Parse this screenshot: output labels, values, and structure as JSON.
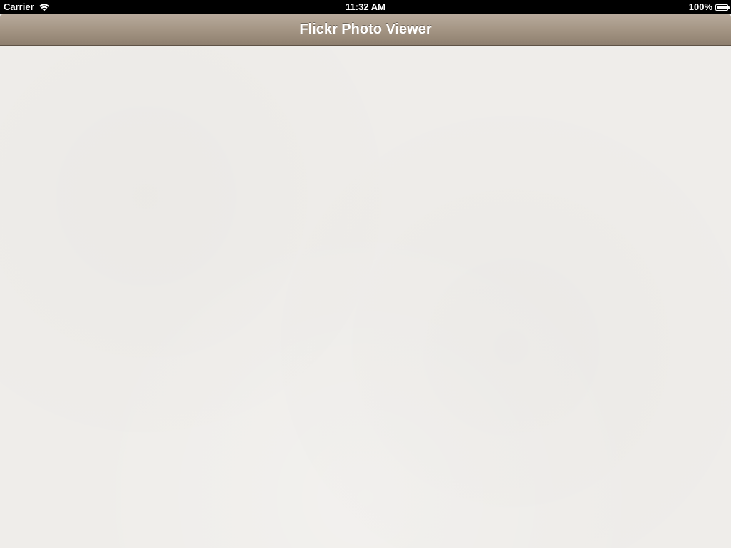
{
  "status_bar": {
    "carrier": "Carrier",
    "time": "11:32 AM",
    "battery": "100%",
    "wifi_icon": "wifi-icon",
    "battery_icon": "battery-icon",
    "battery_level": 1.0
  },
  "nav_bar": {
    "title": "Flickr Photo Viewer",
    "color_top": "#b8aa9c",
    "color_bottom": "#8e7f6f"
  },
  "content": {
    "background_color": "#efedea"
  }
}
